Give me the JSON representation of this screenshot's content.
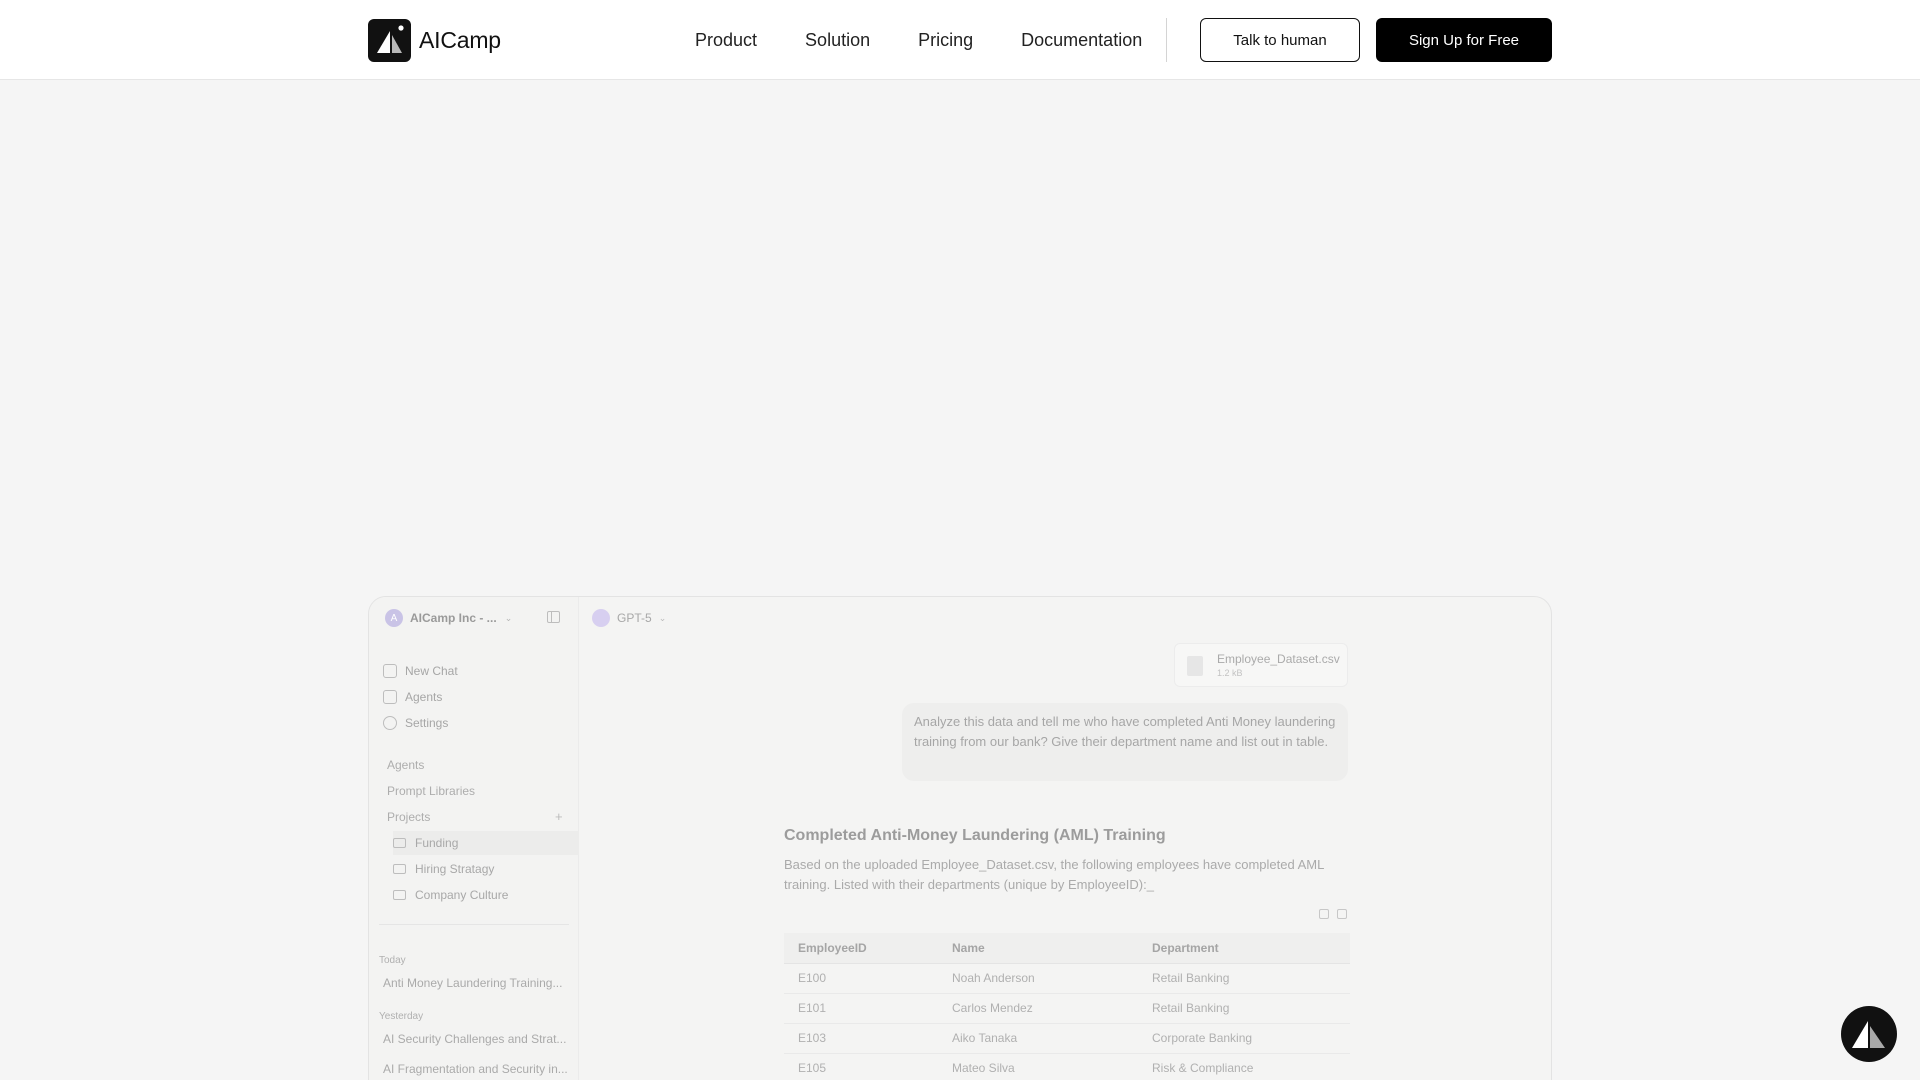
{
  "header": {
    "brand": "AICamp",
    "nav": [
      "Product",
      "Solution",
      "Pricing",
      "Documentation"
    ],
    "talk_button": "Talk to human",
    "signup_button": "Sign Up for Free"
  },
  "preview": {
    "sidebar": {
      "workspace_initial": "A",
      "workspace_name": "AICamp Inc - ...",
      "menu": [
        "New Chat",
        "Agents",
        "Settings"
      ],
      "sections": {
        "agents": "Agents",
        "prompt_libraries": "Prompt Libraries",
        "projects": "Projects"
      },
      "projects": [
        "Funding",
        "Hiring Stratagy",
        "Company Culture"
      ],
      "today_label": "Today",
      "today_items": [
        "Anti Money Laundering Training..."
      ],
      "yesterday_label": "Yesterday",
      "yesterday_items": [
        "AI Security Challenges and Strat...",
        "AI Fragmentation and Security in..."
      ]
    },
    "main": {
      "model": "GPT-5",
      "file": {
        "name": "Employee_Dataset.csv",
        "size": "1.2 kB"
      },
      "user_message": "Analyze this data and tell me who have completed Anti Money laundering training from our bank? Give their department name and list out in table.",
      "answer_title": "Completed Anti-Money Laundering (AML) Training",
      "answer_body": "Based on the uploaded Employee_Dataset.csv, the following employees have completed AML training. Listed with their departments (unique by EmployeeID):_",
      "table": {
        "headers": [
          "EmployeeID",
          "Name",
          "Department"
        ],
        "rows": [
          [
            "E100",
            "Noah Anderson",
            "Retail Banking"
          ],
          [
            "E101",
            "Carlos Mendez",
            "Retail Banking"
          ],
          [
            "E103",
            "Aiko Tanaka",
            "Corporate Banking"
          ],
          [
            "E105",
            "Mateo Silva",
            "Risk & Compliance"
          ]
        ]
      }
    }
  }
}
